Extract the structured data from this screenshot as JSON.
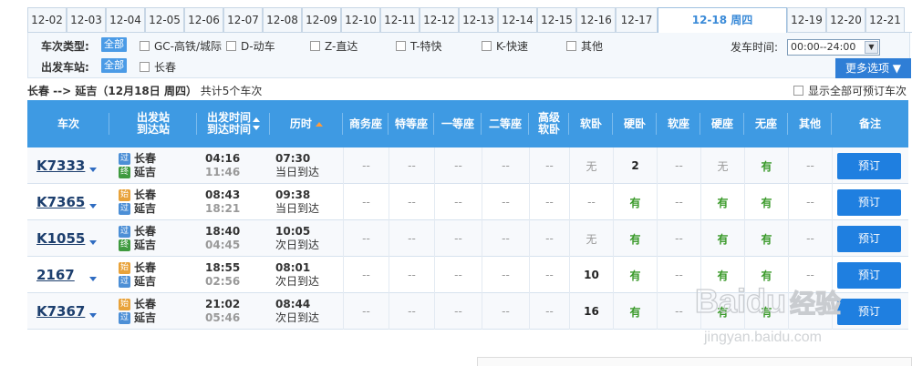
{
  "dates": [
    {
      "label": "12-02"
    },
    {
      "label": "12-03"
    },
    {
      "label": "12-04"
    },
    {
      "label": "12-05"
    },
    {
      "label": "12-06"
    },
    {
      "label": "12-07"
    },
    {
      "label": "12-08"
    },
    {
      "label": "12-09"
    },
    {
      "label": "12-10"
    },
    {
      "label": "12-11"
    },
    {
      "label": "12-12"
    },
    {
      "label": "12-13"
    },
    {
      "label": "12-14"
    },
    {
      "label": "12-15"
    },
    {
      "label": "12-16"
    },
    {
      "label": "12-17"
    },
    {
      "label": "12-18 周四",
      "active": true
    },
    {
      "label": "12-19"
    },
    {
      "label": "12-20"
    },
    {
      "label": "12-21"
    }
  ],
  "filters": {
    "type_label": "车次类型:",
    "all_label": "全部",
    "types": [
      "GC-高铁/城际",
      "D-动车",
      "Z-直达",
      "T-特快",
      "K-快速",
      "其他"
    ],
    "station_label": "出发车站:",
    "stations": [
      "长春"
    ],
    "time_label": "发车时间:",
    "time_value": "00:00--24:00",
    "more_label": "更多选项"
  },
  "summary": {
    "route": "长春 --> 延吉",
    "date": "（12月18日 周四）",
    "count": "共计5个车次",
    "show_all": "显示全部可预订车次"
  },
  "headers": {
    "train": "车次",
    "stations_1": "出发站",
    "stations_2": "到达站",
    "times_1": "出发时间",
    "times_2": "到达时间",
    "duration": "历时",
    "business": "商务座",
    "special": "特等座",
    "first": "一等座",
    "second": "二等座",
    "premium_1": "高级",
    "premium_2": "软卧",
    "soft_sleeper": "软卧",
    "hard_sleeper": "硬卧",
    "soft_seat": "软座",
    "hard_seat": "硬座",
    "no_seat": "无座",
    "other": "其他",
    "note": "备注"
  },
  "rows": [
    {
      "code": "K7333",
      "from": "长春",
      "to": "延吉",
      "from_badge": "过",
      "to_badge": "终",
      "depart": "04:16",
      "arrive": "11:46",
      "duration": "07:30",
      "arrive_day": "当日到达",
      "seats": [
        "--",
        "--",
        "--",
        "--",
        "--",
        "无",
        "2",
        "--",
        "无",
        "有",
        "--"
      ],
      "book": "预订"
    },
    {
      "code": "K7365",
      "from": "长春",
      "to": "延吉",
      "from_badge": "始",
      "to_badge": "过",
      "depart": "08:43",
      "arrive": "18:21",
      "duration": "09:38",
      "arrive_day": "当日到达",
      "seats": [
        "--",
        "--",
        "--",
        "--",
        "--",
        "--",
        "有",
        "--",
        "有",
        "有",
        "--"
      ],
      "book": "预订"
    },
    {
      "code": "K1055",
      "from": "长春",
      "to": "延吉",
      "from_badge": "过",
      "to_badge": "终",
      "depart": "18:40",
      "arrive": "04:45",
      "duration": "10:05",
      "arrive_day": "次日到达",
      "seats": [
        "--",
        "--",
        "--",
        "--",
        "--",
        "无",
        "有",
        "--",
        "有",
        "有",
        "--"
      ],
      "book": "预订"
    },
    {
      "code": "2167",
      "from": "长春",
      "to": "延吉",
      "from_badge": "始",
      "to_badge": "过",
      "depart": "18:55",
      "arrive": "02:56",
      "duration": "08:01",
      "arrive_day": "次日到达",
      "seats": [
        "--",
        "--",
        "--",
        "--",
        "--",
        "10",
        "有",
        "--",
        "有",
        "有",
        "--"
      ],
      "book": "预订"
    },
    {
      "code": "K7367",
      "from": "长春",
      "to": "延吉",
      "from_badge": "始",
      "to_badge": "过",
      "depart": "21:02",
      "arrive": "05:46",
      "duration": "08:44",
      "arrive_day": "次日到达",
      "seats": [
        "--",
        "--",
        "--",
        "--",
        "--",
        "16",
        "有",
        "--",
        "有",
        "有",
        "--"
      ],
      "book": "预订"
    }
  ],
  "watermark": {
    "logo": "Baidu",
    "text": "经验",
    "url": "jingyan.baidu.com"
  },
  "colors": {
    "header_blue": "#3e9ae3",
    "book_blue": "#1f7fe0",
    "available_green": "#3a9a2a",
    "active_date": "#3b8bd8",
    "badge_orange": "#e8a23a",
    "badge_blue": "#4c8fd6",
    "badge_green": "#3f9a3f"
  }
}
